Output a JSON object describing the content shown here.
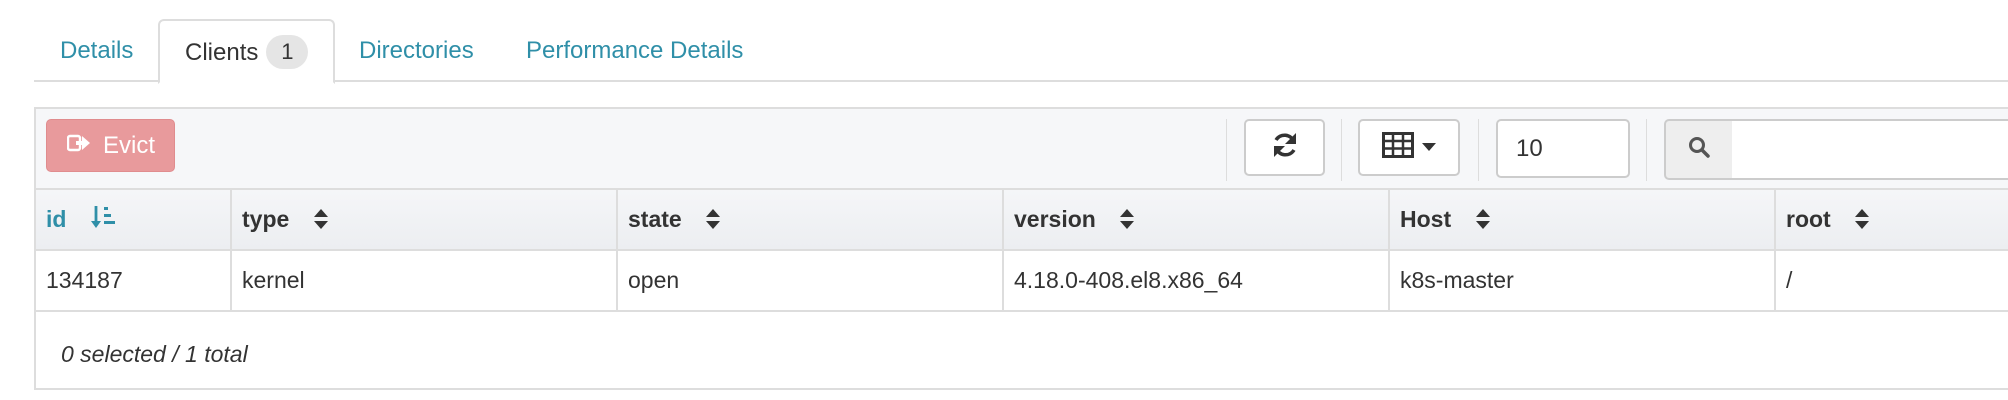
{
  "tabs": [
    {
      "label": "Details"
    },
    {
      "label": "Clients",
      "badge": "1",
      "active": true
    },
    {
      "label": "Directories"
    },
    {
      "label": "Performance Details"
    }
  ],
  "toolbar": {
    "evict_label": "Evict",
    "page_size": "10",
    "search_value": ""
  },
  "table": {
    "columns": [
      {
        "label": "id",
        "sort": "ascending"
      },
      {
        "label": "type",
        "sort": "none"
      },
      {
        "label": "state",
        "sort": "none"
      },
      {
        "label": "version",
        "sort": "none"
      },
      {
        "label": "Host",
        "sort": "none"
      },
      {
        "label": "root",
        "sort": "none"
      }
    ],
    "rows": [
      [
        "134187",
        "kernel",
        "open",
        "4.18.0-408.el8.x86_64",
        "k8s-master",
        "/"
      ]
    ]
  },
  "footer": {
    "selection_summary": "0 selected / 1 total"
  },
  "colors": {
    "link": "#2f8fa8",
    "evict_button": "#e89a9c",
    "border": "#dddddd",
    "badge": "#e5e5e5"
  }
}
